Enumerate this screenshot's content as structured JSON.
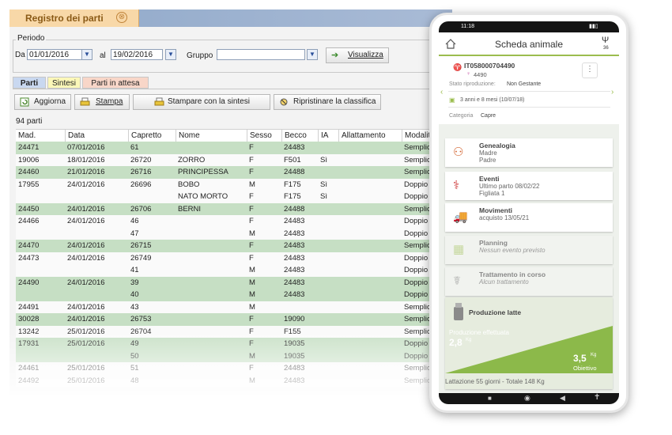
{
  "window": {
    "title": "Registro dei parti",
    "close_glyph": "⊗"
  },
  "filter": {
    "period_label": "Periodo",
    "from_label": "Da",
    "from_value": "01/01/2016",
    "to_label": "al",
    "to_value": "19/02/2016",
    "group_label": "Gruppo",
    "group_value": "",
    "show_button": "Visualizza"
  },
  "tabs": [
    "Parti",
    "Sintesi",
    "Parti in attesa"
  ],
  "toolbar": {
    "refresh": "Aggiorna",
    "print": "Stampa",
    "print_summary": "Stampare con la sintesi",
    "restore": "Ripristinare la classifica"
  },
  "count_label": "94 parti",
  "table": {
    "columns": [
      "Mad.",
      "Data",
      "Capretto",
      "Nome",
      "Sesso",
      "Becco",
      "IA",
      "Allattamento",
      "Modalit"
    ],
    "rows": [
      {
        "g": true,
        "c": [
          "24471",
          "07/01/2016",
          "61",
          "",
          "F",
          "24483",
          "",
          "",
          "Semplic"
        ]
      },
      {
        "g": false,
        "c": [
          "19006",
          "18/01/2016",
          "26720",
          "ZORRO",
          "F",
          "F501",
          "Sì",
          "",
          "Semplic"
        ]
      },
      {
        "g": true,
        "c": [
          "24460",
          "21/01/2016",
          "26716",
          "PRINCIPESSA",
          "F",
          "24488",
          "",
          "",
          "Semplic"
        ]
      },
      {
        "g": false,
        "c": [
          "17955",
          "24/01/2016",
          "26696",
          "BOBO",
          "M",
          "F175",
          "Sì",
          "",
          "Doppio"
        ]
      },
      {
        "g": false,
        "c": [
          "",
          "",
          "",
          "NATO MORTO",
          "F",
          "F175",
          "Sì",
          "",
          "Doppio"
        ]
      },
      {
        "g": true,
        "c": [
          "24450",
          "24/01/2016",
          "26706",
          "BERNI",
          "F",
          "24488",
          "",
          "",
          "Semplic"
        ]
      },
      {
        "g": false,
        "c": [
          "24466",
          "24/01/2016",
          "46",
          "",
          "F",
          "24483",
          "",
          "",
          "Doppio"
        ]
      },
      {
        "g": false,
        "c": [
          "",
          "",
          "47",
          "",
          "M",
          "24483",
          "",
          "",
          "Doppio"
        ]
      },
      {
        "g": true,
        "c": [
          "24470",
          "24/01/2016",
          "26715",
          "",
          "F",
          "24483",
          "",
          "",
          "Semplic"
        ]
      },
      {
        "g": false,
        "c": [
          "24473",
          "24/01/2016",
          "26749",
          "",
          "F",
          "24483",
          "",
          "",
          "Doppio"
        ]
      },
      {
        "g": false,
        "c": [
          "",
          "",
          "41",
          "",
          "M",
          "24483",
          "",
          "",
          "Doppio"
        ]
      },
      {
        "g": true,
        "c": [
          "24490",
          "24/01/2016",
          "39",
          "",
          "M",
          "24483",
          "",
          "",
          "Doppio"
        ]
      },
      {
        "g": true,
        "c": [
          "",
          "",
          "40",
          "",
          "M",
          "24483",
          "",
          "",
          "Doppio"
        ]
      },
      {
        "g": false,
        "c": [
          "24491",
          "24/01/2016",
          "43",
          "",
          "M",
          "",
          "",
          "",
          "Semplic"
        ]
      },
      {
        "g": true,
        "c": [
          "30028",
          "24/01/2016",
          "26753",
          "",
          "F",
          "19090",
          "",
          "",
          "Semplic"
        ]
      },
      {
        "g": false,
        "c": [
          "13242",
          "25/01/2016",
          "26704",
          "",
          "F",
          "F155",
          "",
          "",
          "Semplic"
        ]
      },
      {
        "g": true,
        "c": [
          "17931",
          "25/01/2016",
          "49",
          "",
          "F",
          "19035",
          "",
          "",
          "Doppio"
        ]
      },
      {
        "g": true,
        "c": [
          "",
          "",
          "50",
          "",
          "M",
          "19035",
          "",
          "",
          "Doppio"
        ]
      },
      {
        "g": false,
        "c": [
          "24461",
          "25/01/2016",
          "51",
          "",
          "F",
          "24483",
          "",
          "",
          "Semplic"
        ]
      },
      {
        "g": false,
        "c": [
          "24492",
          "25/01/2016",
          "48",
          "",
          "M",
          "24483",
          "",
          "",
          "Semplic"
        ]
      }
    ]
  },
  "phone": {
    "status_time": "11:18",
    "title": "Scheda animale",
    "badge_count": "36",
    "animal_id": "IT058000704490",
    "animal_short": "4490",
    "repro_label": "Stato riproduzione:",
    "repro_value": "Non Gestante",
    "age": "3 anni e 8 mesi (10/07/18)",
    "category_label": "Categoria",
    "category_value": "Capre",
    "menu": [
      {
        "title": "Genealogia",
        "line1": "Madre",
        "line2": "Padre",
        "dim": false
      },
      {
        "title": "Eventi",
        "line1": "Ultimo parto 08/02/22",
        "line2": "Figliata 1",
        "dim": false
      },
      {
        "title": "Movimenti",
        "line1": "acquisto 13/05/21",
        "line2": "",
        "dim": false
      },
      {
        "title": "Planning",
        "line1": "Nessun evento previsto",
        "line2": "",
        "dim": true
      },
      {
        "title": "Trattamento in corso",
        "line1": "Alcun trattamento",
        "line2": "",
        "dim": true
      }
    ],
    "milk": {
      "title": "Produzione latte",
      "effective_label": "Produzione effettuata",
      "effective_value": "2,8",
      "unit": "Kg",
      "target_value": "3,5",
      "target_label": "Obiettivo",
      "footer": "Lattazione 55 giorni - Totale 148 Kg"
    }
  },
  "colors": {
    "accent_green": "#9bbd4e",
    "row_green": "#c6dfc4",
    "title_orange": "#8a5a16"
  }
}
